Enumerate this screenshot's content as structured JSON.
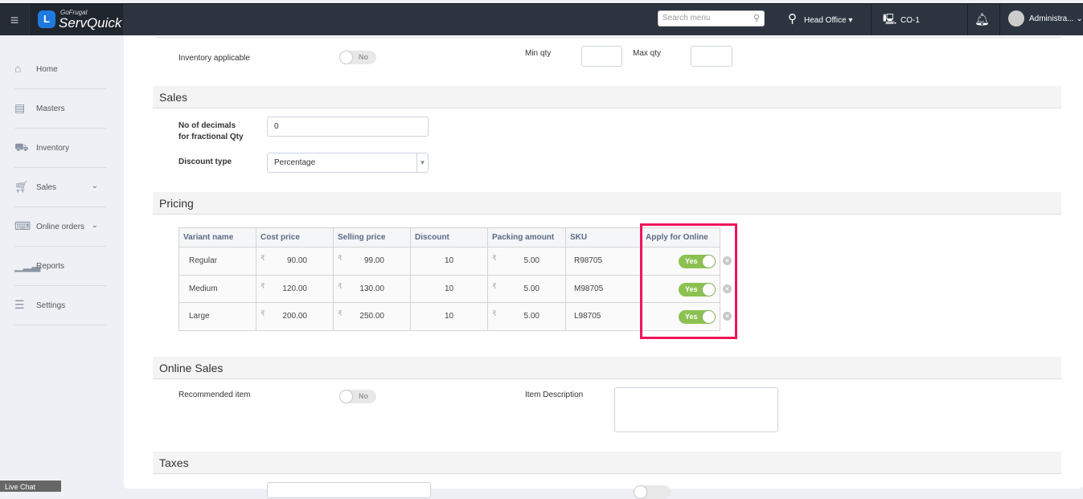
{
  "header": {
    "brand_small": "GoFrugal",
    "brand": "ServQuick",
    "search_placeholder": "Search menu",
    "location": "Head Office",
    "counter": "CO-1",
    "user": "Administra..."
  },
  "sidebar": {
    "items": [
      {
        "label": "Home"
      },
      {
        "label": "Masters"
      },
      {
        "label": "Inventory"
      },
      {
        "label": "Sales"
      },
      {
        "label": "Online orders"
      },
      {
        "label": "Reports"
      },
      {
        "label": "Settings"
      }
    ]
  },
  "inventory": {
    "label": "Inventory applicable",
    "toggle": "No",
    "min_qty_label": "Min qty",
    "max_qty_label": "Max qty",
    "min_qty": "",
    "max_qty": ""
  },
  "sales": {
    "title": "Sales",
    "decimals_label_1": "No of decimals",
    "decimals_label_2": "for fractional Qty",
    "decimals_value": "0",
    "discount_type_label": "Discount type",
    "discount_type_value": "Percentage"
  },
  "pricing": {
    "title": "Pricing",
    "columns": [
      "Variant name",
      "Cost price",
      "Selling price",
      "Discount",
      "Packing amount",
      "SKU",
      "Apply for Online"
    ],
    "currency": "₹",
    "rows": [
      {
        "name": "Regular",
        "cost": "90.00",
        "selling": "99.00",
        "discount": "10",
        "packing": "5.00",
        "sku": "R98705",
        "online": "Yes"
      },
      {
        "name": "Medium",
        "cost": "120.00",
        "selling": "130.00",
        "discount": "10",
        "packing": "5.00",
        "sku": "M98705",
        "online": "Yes"
      },
      {
        "name": "Large",
        "cost": "200.00",
        "selling": "250.00",
        "discount": "10",
        "packing": "5.00",
        "sku": "L98705",
        "online": "Yes"
      }
    ]
  },
  "online_sales": {
    "title": "Online Sales",
    "recommended_label": "Recommended item",
    "recommended_toggle": "No",
    "description_label": "Item Description",
    "description": ""
  },
  "taxes": {
    "title": "Taxes"
  },
  "livechat": "Live Chat"
}
